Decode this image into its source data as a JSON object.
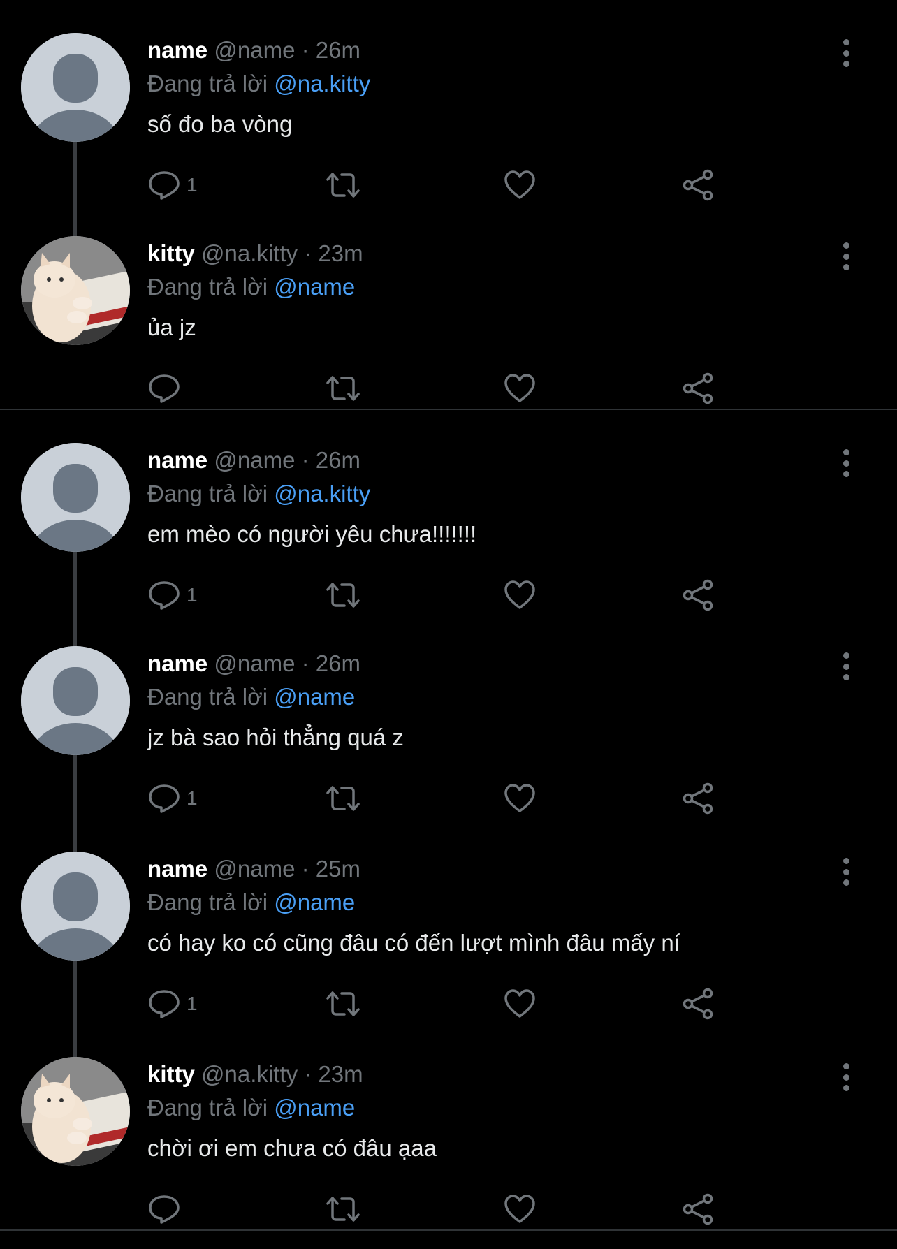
{
  "colors": {
    "background": "#000000",
    "muted": "#71767b",
    "mention": "#4a9ff5",
    "divider": "#2f3336"
  },
  "threads": [
    {
      "tweets": [
        {
          "avatar": "default-avatar",
          "name": "name",
          "handle": "@name",
          "sep": "·",
          "time": "26m",
          "reply_prefix": "Đang trả lời",
          "reply_to": "@na.kitty",
          "text": "số đo ba vòng",
          "reply_count": "1"
        },
        {
          "avatar": "cat-avatar",
          "name": "kitty",
          "handle": "@na.kitty",
          "sep": "·",
          "time": "23m",
          "reply_prefix": "Đang trả lời",
          "reply_to": "@name",
          "text": "ủa jz",
          "reply_count": ""
        }
      ]
    },
    {
      "tweets": [
        {
          "avatar": "default-avatar",
          "name": "name",
          "handle": "@name",
          "sep": "·",
          "time": "26m",
          "reply_prefix": "Đang trả lời",
          "reply_to": "@na.kitty",
          "text": "em mèo có người yêu chưa!!!!!!!",
          "reply_count": "1"
        },
        {
          "avatar": "default-avatar",
          "name": "name",
          "handle": "@name",
          "sep": "·",
          "time": "26m",
          "reply_prefix": "Đang trả lời",
          "reply_to": "@name",
          "text": "jz bà sao hỏi thẳng quá z",
          "reply_count": "1"
        },
        {
          "avatar": "default-avatar",
          "name": "name",
          "handle": "@name",
          "sep": "·",
          "time": "25m",
          "reply_prefix": "Đang trả lời",
          "reply_to": "@name",
          "text": "có hay ko có cũng đâu có đến lượt mình đâu mấy ní",
          "reply_count": "1"
        },
        {
          "avatar": "cat-avatar",
          "name": "kitty",
          "handle": "@na.kitty",
          "sep": "·",
          "time": "23m",
          "reply_prefix": "Đang trả lời",
          "reply_to": "@name",
          "text": "chời ơi em chưa có đâu ạaa",
          "reply_count": ""
        }
      ]
    }
  ]
}
